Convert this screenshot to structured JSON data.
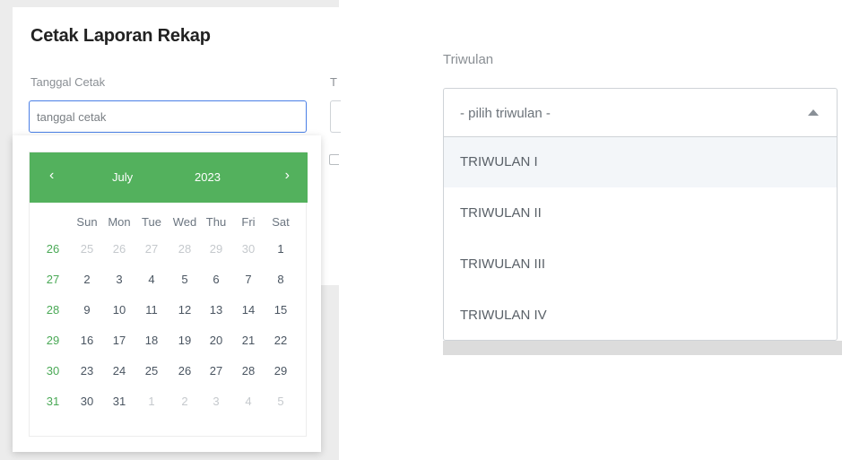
{
  "card": {
    "title": "Cetak Laporan Rekap"
  },
  "date_field": {
    "label": "Tanggal Cetak",
    "placeholder": "tanggal cetak",
    "next_label_partial": "T"
  },
  "calendar": {
    "prev": "‹",
    "next": "›",
    "month": "July",
    "year": "2023",
    "weekdays": [
      "Sun",
      "Mon",
      "Tue",
      "Wed",
      "Thu",
      "Fri",
      "Sat"
    ],
    "weeks": [
      {
        "week": "26",
        "days": [
          "25",
          "26",
          "27",
          "28",
          "29",
          "30",
          "1"
        ]
      },
      {
        "week": "27",
        "days": [
          "2",
          "3",
          "4",
          "5",
          "6",
          "7",
          "8"
        ]
      },
      {
        "week": "28",
        "days": [
          "9",
          "10",
          "11",
          "12",
          "13",
          "14",
          "15"
        ]
      },
      {
        "week": "29",
        "days": [
          "16",
          "17",
          "18",
          "19",
          "20",
          "21",
          "22"
        ]
      },
      {
        "week": "30",
        "days": [
          "23",
          "24",
          "25",
          "26",
          "27",
          "28",
          "29"
        ]
      },
      {
        "week": "31",
        "days": [
          "30",
          "31",
          "1",
          "2",
          "3",
          "4",
          "5"
        ]
      }
    ]
  },
  "triwulan": {
    "label": "Triwulan",
    "placeholder": "- pilih triwulan -",
    "options": [
      "TRIWULAN I",
      "TRIWULAN II",
      "TRIWULAN III",
      "TRIWULAN IV"
    ]
  },
  "colors": {
    "calendar_header": "#53b15d",
    "focus_border": "#4a7fe6",
    "week_number": "#4aa956"
  }
}
